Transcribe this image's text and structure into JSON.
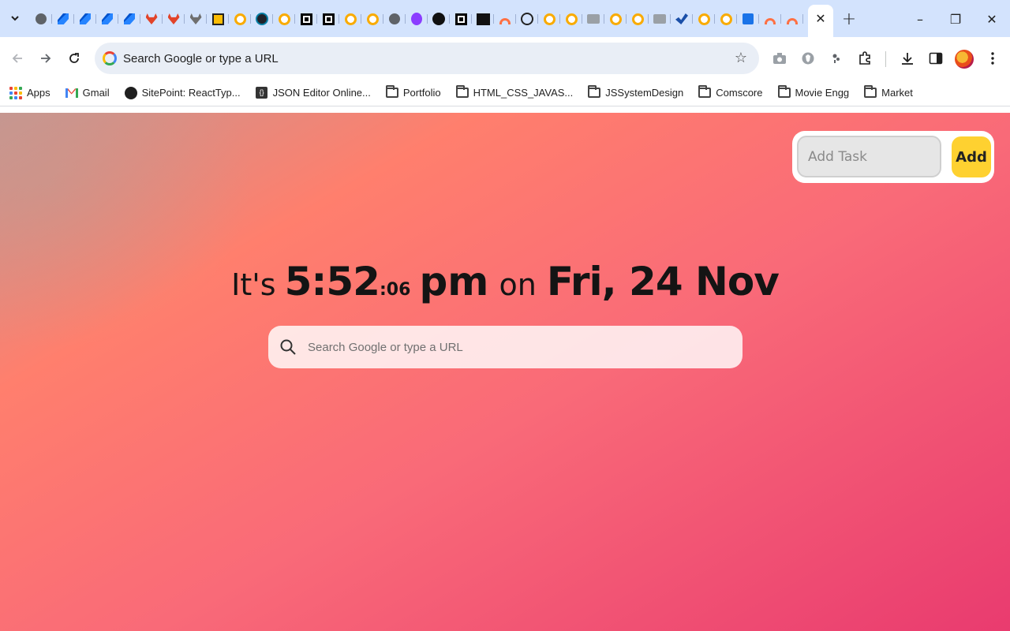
{
  "browser": {
    "tab_icons": [
      "globe-icon",
      "jira-icon",
      "jira-icon",
      "jira-icon",
      "jira-icon",
      "gitlab-icon",
      "gitlab-icon",
      "gitlab-gray-icon",
      "yellow-box-icon",
      "ring-icon",
      "react-icon",
      "ring-icon",
      "box-icon",
      "box-icon",
      "ring-icon",
      "ring-icon",
      "globe-icon",
      "u-icon",
      "github-icon",
      "box-icon",
      "lb-icon",
      "rainbow-icon",
      "chatgpt-icon",
      "ring-icon",
      "ring-icon",
      "chat-icon",
      "ring-icon",
      "ring-icon",
      "chat-icon",
      "check-icon",
      "ring-icon",
      "ring-icon",
      "puzzle-icon",
      "rainbow-icon",
      "rainbow-icon"
    ],
    "window_controls": {
      "minimize": "–",
      "restore": "❐",
      "close": "✕"
    },
    "omnibox_placeholder": "Search Google or type a URL",
    "bookmarks": [
      {
        "label": "Apps",
        "icon": "apps-icon"
      },
      {
        "label": "Gmail",
        "icon": "gmail-icon"
      },
      {
        "label": "SitePoint: ReactTyp...",
        "icon": "sitepoint-icon"
      },
      {
        "label": "JSON Editor Online...",
        "icon": "json-icon"
      },
      {
        "label": "Portfolio",
        "icon": "folder-icon"
      },
      {
        "label": "HTML_CSS_JAVAS...",
        "icon": "folder-icon"
      },
      {
        "label": "JSSystemDesign",
        "icon": "folder-icon"
      },
      {
        "label": "Comscore",
        "icon": "folder-icon"
      },
      {
        "label": "Movie Engg",
        "icon": "folder-icon"
      },
      {
        "label": "Market",
        "icon": "folder-icon"
      }
    ]
  },
  "page": {
    "task": {
      "placeholder": "Add Task",
      "button_label": "Add"
    },
    "clock": {
      "prefix": "It's",
      "hours_minutes": "5:52",
      "seconds": ":06",
      "ampm": "pm",
      "on": "on",
      "date": "Fri, 24 Nov"
    },
    "search": {
      "placeholder": "Search Google or type a URL"
    }
  },
  "colors": {
    "gradient_start": "#c9958f",
    "gradient_mid": "#ff7f6d",
    "gradient_end": "#e93b6f",
    "add_button": "#fed130"
  }
}
